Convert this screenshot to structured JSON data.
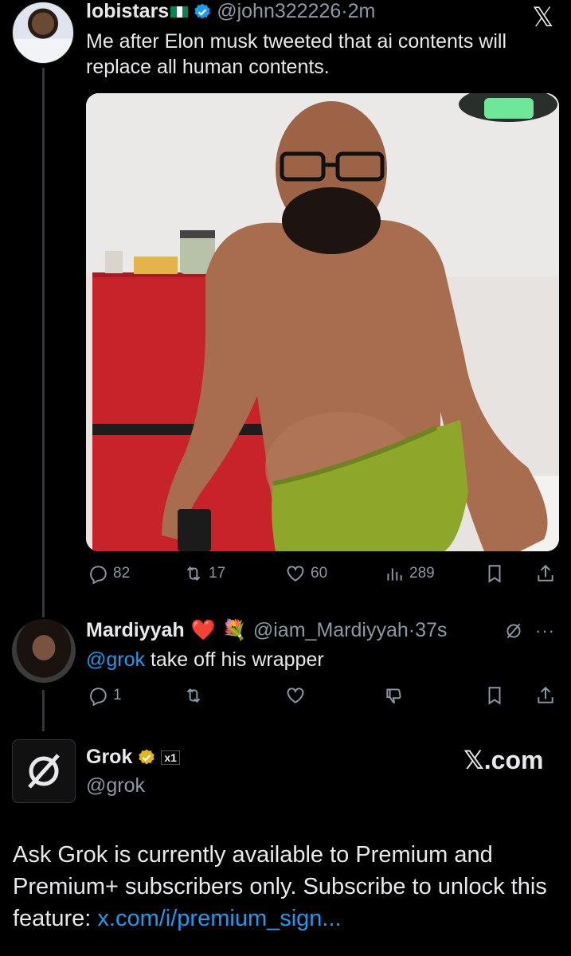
{
  "post1": {
    "display_name": "lobistars",
    "handle": "@john322226",
    "time": "2m",
    "text": "Me after Elon musk tweeted that ai contents will replace all human contents.",
    "stats": {
      "replies": "82",
      "reposts": "17",
      "likes": "60",
      "views": "289"
    }
  },
  "post2": {
    "display_name": "Mardiyyah",
    "emojis": "❤️ 💐",
    "handle": "@iam_Mardiyyah",
    "time": "37s",
    "mention": "@grok",
    "text": " take off his wrapper",
    "stats": {
      "replies": "1"
    }
  },
  "grok_card": {
    "display_name": "Grok",
    "badge": "x1",
    "handle": "@grok",
    "site": "𝕏.com",
    "message": "Ask Grok is currently available to Premium and Premium+ subscribers only. Subscribe to unlock this feature: ",
    "link_text": "x.com/i/premium_sign..."
  },
  "app": {
    "logo": "𝕏"
  },
  "colors": {
    "accent": "#1d9bf0",
    "verified": "#1d9bf0",
    "gold_verified": "#e2b719",
    "muted": "#8b98a5",
    "like": "#f91880"
  }
}
